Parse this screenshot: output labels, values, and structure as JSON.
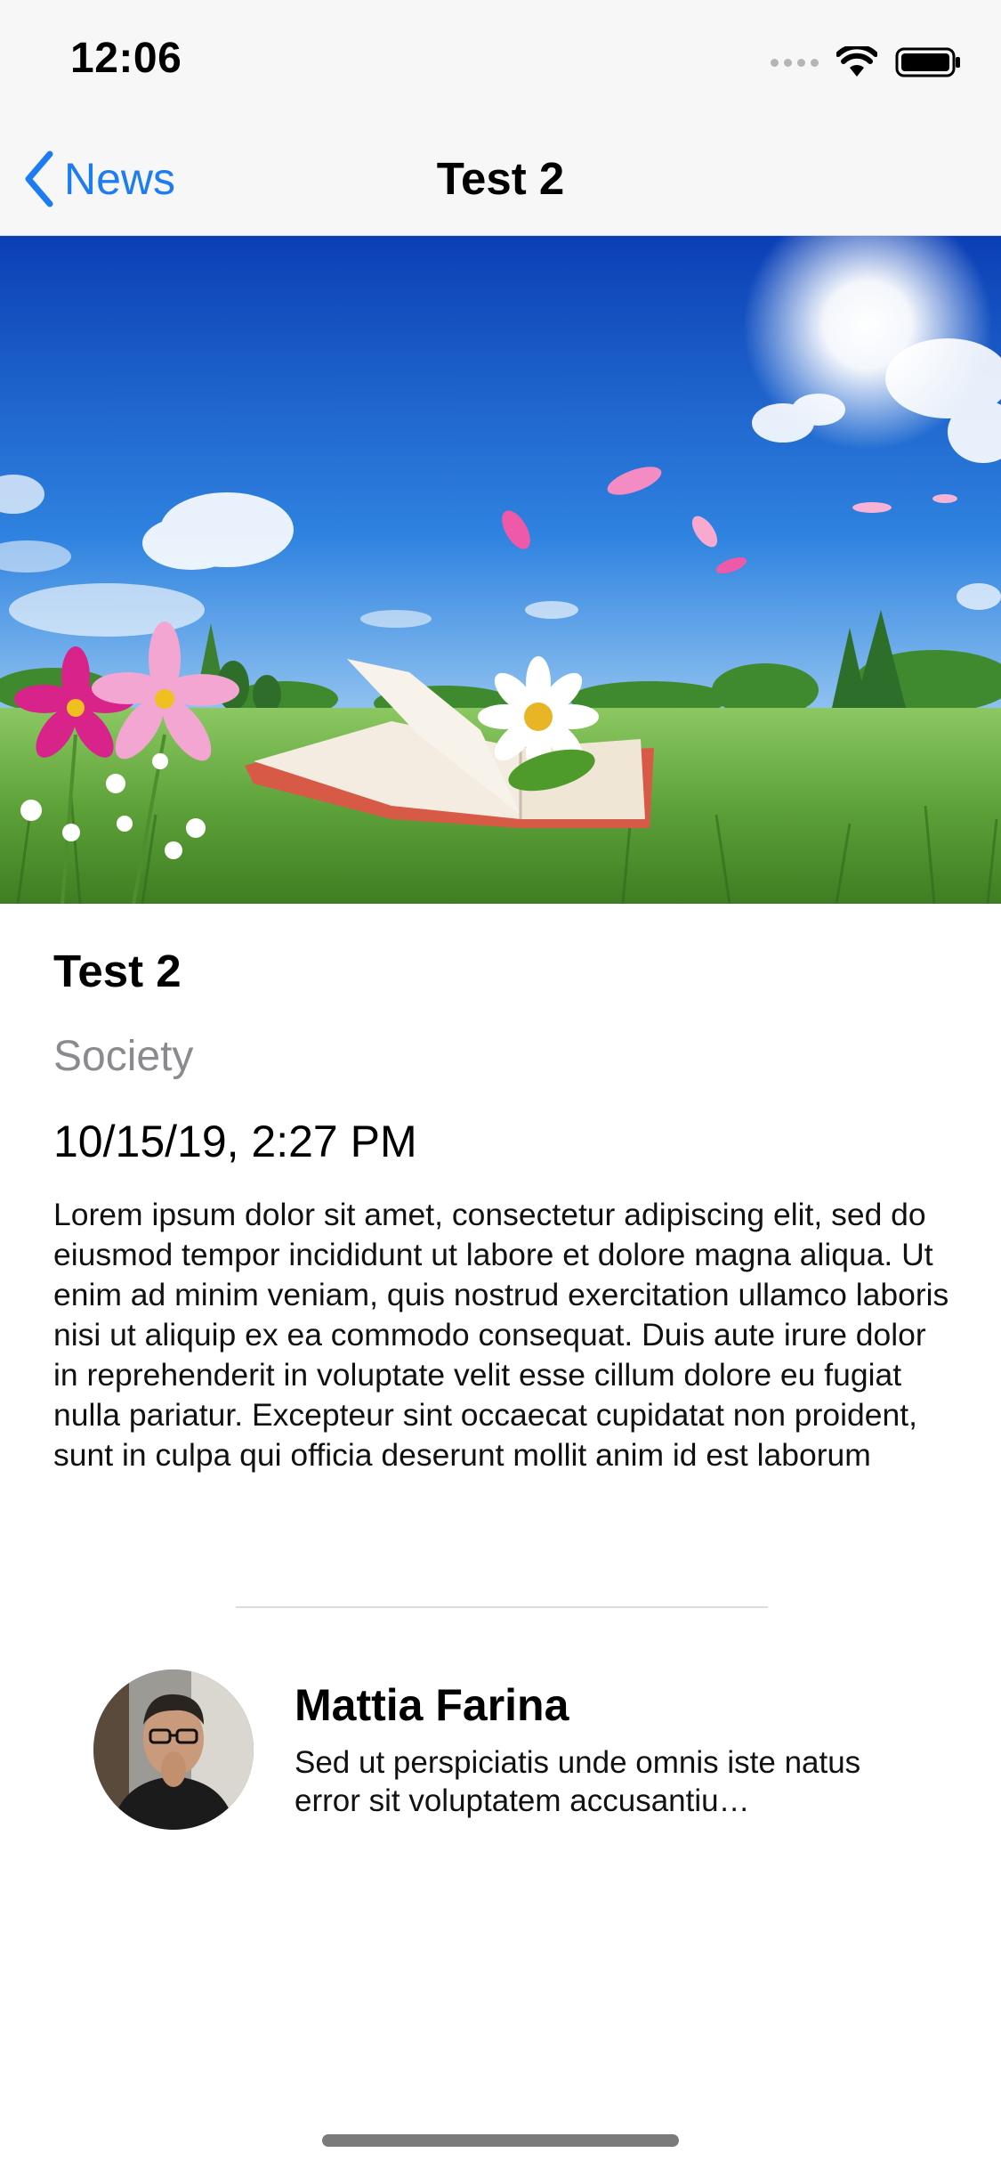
{
  "status_bar": {
    "time": "12:06",
    "icons": [
      "cellular-signal-icon",
      "wifi-icon",
      "battery-icon"
    ]
  },
  "nav": {
    "back_label": "News",
    "back_icon": "chevron-left-icon",
    "title": "Test 2",
    "accent_color": "#1e7cf2"
  },
  "hero": {
    "image": "meadow-with-open-book-and-flowers"
  },
  "article": {
    "title": "Test 2",
    "category": "Society",
    "date": "10/15/19, 2:27 PM",
    "body": "Lorem ipsum dolor sit amet, consectetur adipiscing elit, sed do eiusmod tempor incididunt ut labore et dolore magna aliqua. Ut enim ad minim veniam, quis nostrud exercitation ullamco laboris nisi ut aliquip ex ea commodo consequat. Duis aute irure dolor in reprehenderit in voluptate velit esse cillum dolore eu fugiat nulla pariatur. Excepteur sint occaecat cupidatat non proident, sunt in culpa qui officia deserunt mollit anim id est laborum"
  },
  "author": {
    "name": "Mattia Farina",
    "bio": "Sed ut perspiciatis unde omnis iste natus error sit voluptatem accusantiu…",
    "avatar": "author-avatar-photo"
  }
}
